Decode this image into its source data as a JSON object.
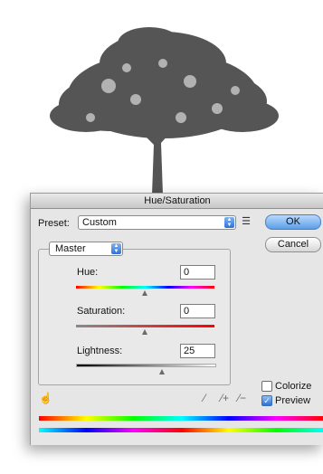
{
  "background": {
    "image": "tree-silhouette"
  },
  "dialog": {
    "title": "Hue/Saturation",
    "preset": {
      "label": "Preset:",
      "value": "Custom",
      "options_icon": "preset-options-icon"
    },
    "buttons": {
      "ok": "OK",
      "cancel": "Cancel"
    },
    "channel": {
      "value": "Master"
    },
    "hue": {
      "label": "Hue:",
      "value": "0",
      "slider_fraction": 0.5
    },
    "saturation": {
      "label": "Saturation:",
      "value": "0",
      "slider_fraction": 0.5
    },
    "lightness": {
      "label": "Lightness:",
      "value": "25",
      "slider_fraction": 0.625
    },
    "colorize": {
      "label": "Colorize",
      "checked": false
    },
    "preview": {
      "label": "Preview",
      "checked": true
    },
    "tools": {
      "targeted_adjust": "hand-adjust-icon",
      "eyedropper": "eyedropper-icon",
      "add_sample": "eyedropper-plus-icon",
      "subtract_sample": "eyedropper-minus-icon"
    },
    "colors": {
      "ok_button": "#5c9ee9",
      "checkbox_accent": "#2d70d6"
    }
  }
}
